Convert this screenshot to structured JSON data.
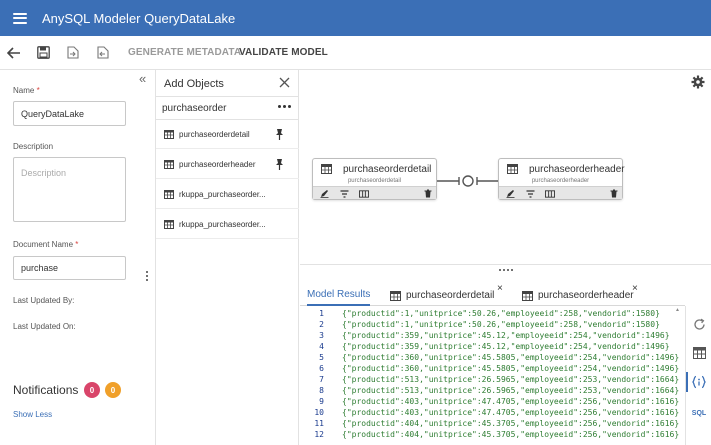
{
  "header": {
    "app_title": "AnySQL Modeler QueryDataLake"
  },
  "toolbar": {
    "generate_label": "GENERATE METADATA",
    "validate_label": "VALIDATE MODEL"
  },
  "left_panel": {
    "name_label": "Name",
    "name_value": "QueryDataLake",
    "description_label": "Description",
    "description_placeholder": "Description",
    "document_name_label": "Document Name",
    "document_name_value": "purchase",
    "required_mark": "*",
    "last_updated_by_label": "Last Updated By:",
    "last_updated_on_label": "Last Updated On:",
    "notifications_label": "Notifications",
    "notification_counts": [
      "0",
      "0"
    ],
    "show_less_label": "Show Less"
  },
  "add_objects": {
    "title": "Add Objects",
    "search_value": "purchaseorder",
    "items": [
      {
        "label": "purchaseorderdetail",
        "pinned": true
      },
      {
        "label": "purchaseorderheader",
        "pinned": true
      },
      {
        "label": "rkuppa_purchaseorder...",
        "pinned": false
      },
      {
        "label": "rkuppa_purchaseorder...",
        "pinned": false
      }
    ]
  },
  "canvas": {
    "nodes": [
      {
        "title": "purchaseorderdetail",
        "subtitle": "purchaseorderdetail"
      },
      {
        "title": "purchaseorderheader",
        "subtitle": "purchaseorderheader"
      }
    ]
  },
  "results": {
    "tabs": [
      {
        "label": "Model Results",
        "active": true,
        "closable": false
      },
      {
        "label": "purchaseorderdetail",
        "active": false,
        "closable": true
      },
      {
        "label": "purchaseorderheader",
        "active": false,
        "closable": true
      }
    ],
    "close_glyph": "×",
    "lines": [
      {
        "n": "1",
        "text": "{\"productid\":1,\"unitprice\":50.26,\"employeeid\":258,\"vendorid\":1580}"
      },
      {
        "n": "2",
        "text": "{\"productid\":1,\"unitprice\":50.26,\"employeeid\":258,\"vendorid\":1580}"
      },
      {
        "n": "3",
        "text": "{\"productid\":359,\"unitprice\":45.12,\"employeeid\":254,\"vendorid\":1496}"
      },
      {
        "n": "4",
        "text": "{\"productid\":359,\"unitprice\":45.12,\"employeeid\":254,\"vendorid\":1496}"
      },
      {
        "n": "5",
        "text": "{\"productid\":360,\"unitprice\":45.5805,\"employeeid\":254,\"vendorid\":1496}"
      },
      {
        "n": "6",
        "text": "{\"productid\":360,\"unitprice\":45.5805,\"employeeid\":254,\"vendorid\":1496}"
      },
      {
        "n": "7",
        "text": "{\"productid\":513,\"unitprice\":26.5965,\"employeeid\":253,\"vendorid\":1664}"
      },
      {
        "n": "8",
        "text": "{\"productid\":513,\"unitprice\":26.5965,\"employeeid\":253,\"vendorid\":1664}"
      },
      {
        "n": "9",
        "text": "{\"productid\":403,\"unitprice\":47.4705,\"employeeid\":256,\"vendorid\":1616}"
      },
      {
        "n": "10",
        "text": "{\"productid\":403,\"unitprice\":47.4705,\"employeeid\":256,\"vendorid\":1616}"
      },
      {
        "n": "11",
        "text": "{\"productid\":404,\"unitprice\":45.3705,\"employeeid\":256,\"vendorid\":1616}"
      },
      {
        "n": "12",
        "text": "{\"productid\":404,\"unitprice\":45.3705,\"employeeid\":256,\"vendorid\":1616}"
      }
    ]
  },
  "right_sidebar": {
    "sql_label": "SQL"
  },
  "colors": {
    "header_bg": "#3b6fb6",
    "badge_red": "#d9456a",
    "badge_orange": "#f0a02a",
    "code_green": "#2e7d32",
    "line_number_blue": "#1a3b8e"
  },
  "icons": [
    "hamburger-icon",
    "back-arrow-icon",
    "save-icon",
    "export-icon",
    "import-icon",
    "collapse-chevrons-icon",
    "close-icon",
    "more-icon",
    "table-icon",
    "pin-icon",
    "settings-gear-icon",
    "edit-icon",
    "filter-icon",
    "columns-icon",
    "trash-icon",
    "link-connector-icon",
    "refresh-icon",
    "grid-icon",
    "json-icon"
  ]
}
